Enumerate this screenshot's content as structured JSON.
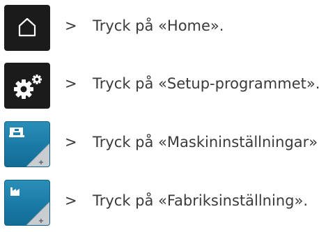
{
  "steps": [
    {
      "arrow": ">",
      "text": "Tryck på «Home».",
      "icon": "home-icon"
    },
    {
      "arrow": ">",
      "text": "Tryck på «Setup-programmet».",
      "icon": "gears-icon"
    },
    {
      "arrow": ">",
      "text": "Tryck på «Maskininställningar».",
      "icon": "sewing-machine-settings-icon"
    },
    {
      "arrow": ">",
      "text": "Tryck på «Fabriksinställning».",
      "icon": "factory-settings-icon"
    }
  ],
  "colors": {
    "dark_button": "#1b1b1b",
    "blue_button": "#1a7aa6",
    "text": "#3a3a3a"
  }
}
